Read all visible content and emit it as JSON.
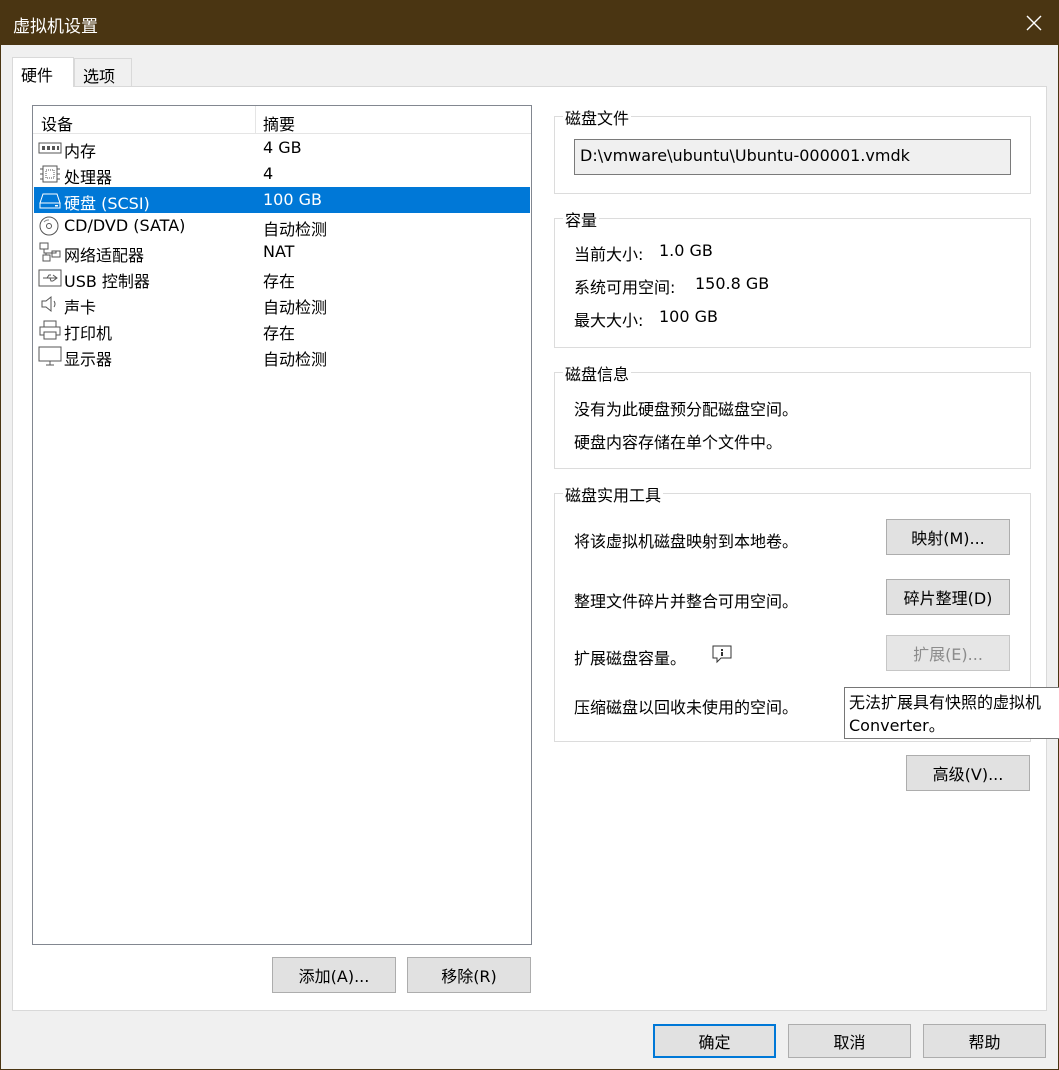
{
  "window": {
    "title": "虚拟机设置"
  },
  "tabs": [
    {
      "label": "硬件",
      "active": true
    },
    {
      "label": "选项",
      "active": false
    }
  ],
  "device_list": {
    "headers": {
      "device": "设备",
      "summary": "摘要"
    },
    "devices": [
      {
        "icon": "memory-icon",
        "name": "内存",
        "summary": "4 GB"
      },
      {
        "icon": "processor-icon",
        "name": "处理器",
        "summary": "4"
      },
      {
        "icon": "hard-disk-icon",
        "name": "硬盘 (SCSI)",
        "summary": "100 GB",
        "selected": true
      },
      {
        "icon": "cd-dvd-icon",
        "name": "CD/DVD (SATA)",
        "summary": "自动检测"
      },
      {
        "icon": "network-adapter-icon",
        "name": "网络适配器",
        "summary": "NAT"
      },
      {
        "icon": "usb-icon",
        "name": "USB 控制器",
        "summary": "存在"
      },
      {
        "icon": "sound-card-icon",
        "name": "声卡",
        "summary": "自动检测"
      },
      {
        "icon": "printer-icon",
        "name": "打印机",
        "summary": "存在"
      },
      {
        "icon": "display-icon",
        "name": "显示器",
        "summary": "自动检测"
      }
    ],
    "add_button": "添加(A)...",
    "remove_button": "移除(R)"
  },
  "disk_file": {
    "legend": "磁盘文件",
    "path": "D:\\vmware\\ubuntu\\Ubuntu-000001.vmdk"
  },
  "capacity": {
    "legend": "容量",
    "current_label": "当前大小:",
    "current_value": "1.0 GB",
    "available_label": "系统可用空间:",
    "available_value": "150.8 GB",
    "max_label": "最大大小:",
    "max_value": "100 GB"
  },
  "disk_info": {
    "legend": "磁盘信息",
    "line1": "没有为此硬盘预分配磁盘空间。",
    "line2": "硬盘内容存储在单个文件中。"
  },
  "disk_utilities": {
    "legend": "磁盘实用工具",
    "map_text": "将该虚拟机磁盘映射到本地卷。",
    "map_button": "映射(M)...",
    "defrag_text": "整理文件碎片并整合可用空间。",
    "defrag_button": "碎片整理(D)",
    "expand_text": "扩展磁盘容量。",
    "expand_button": "扩展(E)...",
    "compact_text": "压缩磁盘以回收未使用的空间。"
  },
  "tooltip": {
    "line1": "无法扩展具有快照的虚拟机",
    "line2": "Converter。"
  },
  "advanced_button": "高级(V)...",
  "footer": {
    "ok": "确定",
    "cancel": "取消",
    "help": "帮助"
  },
  "colors": {
    "titlebar": "#4a3512",
    "selection": "#0078d7"
  }
}
